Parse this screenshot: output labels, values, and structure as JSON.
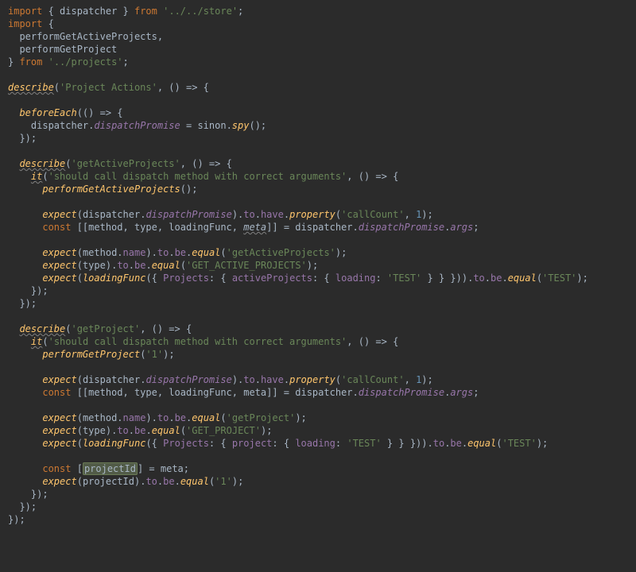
{
  "code": {
    "import1_kw": "import",
    "import1_brace_open": " { ",
    "import1_name": "dispatcher",
    "import1_brace_close": " } ",
    "import1_from": "from",
    "import1_path": "'../../store'",
    "import1_semi": ";",
    "import2_kw": "import",
    "import2_open": " {",
    "import2a": "performGetActiveProjects",
    "import2_comma": ",",
    "import2b": "performGetProject",
    "import2_close_brace": "} ",
    "import2_from": "from",
    "import2_path": "'../projects'",
    "import2_semi": ";",
    "d1_describe": "describe",
    "d1_str": "'Project Actions'",
    "d1_arrow_open": ", () => {",
    "be_fn": "beforeEach",
    "be_open": "(() => {",
    "be_disp": "dispatcher",
    "be_dot1": ".",
    "be_dp": "dispatchPromise ",
    "be_eq": "= ",
    "be_sinon": "sinon",
    "be_dot2": ".",
    "be_spy": "spy",
    "be_call": "();",
    "be_close": "});",
    "d2_describe": "describe",
    "d2_str": "'getActiveProjects'",
    "d2_arrow_open": ", () => {",
    "it1_fn": "it",
    "it1_str": "'should call dispatch method with correct arguments'",
    "it1_arrow_open": ", () => {",
    "it1_call": "performGetActiveProjects",
    "it1_call_p": "();",
    "e1_expect": "expect",
    "e1_disp": "dispatcher",
    "e1_dp": "dispatchPromise",
    "e1_to": "to",
    "e1_have": "have",
    "e1_property": "property",
    "e1_s1": "'callCount'",
    "e1_num": "1",
    "c1_const": "const",
    "c1_destr": " [[method, type, loadingFunc, ",
    "c1_meta": "meta",
    "c1_destr2": "]] = dispatcher.",
    "c1_dp": "dispatchPromise",
    "c1_args": "args",
    "e2_expect": "expect",
    "e2_mname": "method.",
    "e2_name": "name",
    "e2_to": "to",
    "e2_be": "be",
    "e2_equal": "equal",
    "e2_str": "'getActiveProjects'",
    "e3_expect": "expect",
    "e3_type": "type",
    "e3_to": "to",
    "e3_be": "be",
    "e3_equal": "equal",
    "e3_str": "'GET_ACTIVE_PROJECTS'",
    "e4_expect": "expect",
    "e4_lf": "loadingFunc",
    "e4_Projects": "Projects",
    "e4_active": "activeProjects",
    "e4_loading": "loading",
    "e4_test": "'TEST'",
    "e4_to": "to",
    "e4_be": "be",
    "e4_equal": "equal",
    "e4_test2": "'TEST'",
    "it1_close": "});",
    "d2_close": "});",
    "d3_describe": "describe",
    "d3_str": "'getProject'",
    "d3_arrow_open": ", () => {",
    "it2_fn": "it",
    "it2_str": "'should call dispatch method with correct arguments'",
    "it2_arrow_open": ", () => {",
    "it2_call": "performGetProject",
    "it2_arg": "'1'",
    "f1_expect": "expect",
    "f1_s1": "'callCount'",
    "f1_num": "1",
    "c2_const": "const",
    "c2_destr": " [[method, type, loadingFunc, meta]] = dispatcher.",
    "c2_dp": "dispatchPromise",
    "c2_args": "args",
    "g2_str": "'getProject'",
    "g3_str": "'GET_PROJECT'",
    "g4_project": "project",
    "c3_const": "const",
    "c3_open": " [",
    "c3_pid": "projectId",
    "c3_close": "] = meta;",
    "h_expect": "expect",
    "h_pid": "projectId",
    "h_to": "to",
    "h_be": "be",
    "h_equal": "equal",
    "h_str": "'1'",
    "it2_close": "});",
    "d3_close": "});",
    "d1_close": "});"
  }
}
